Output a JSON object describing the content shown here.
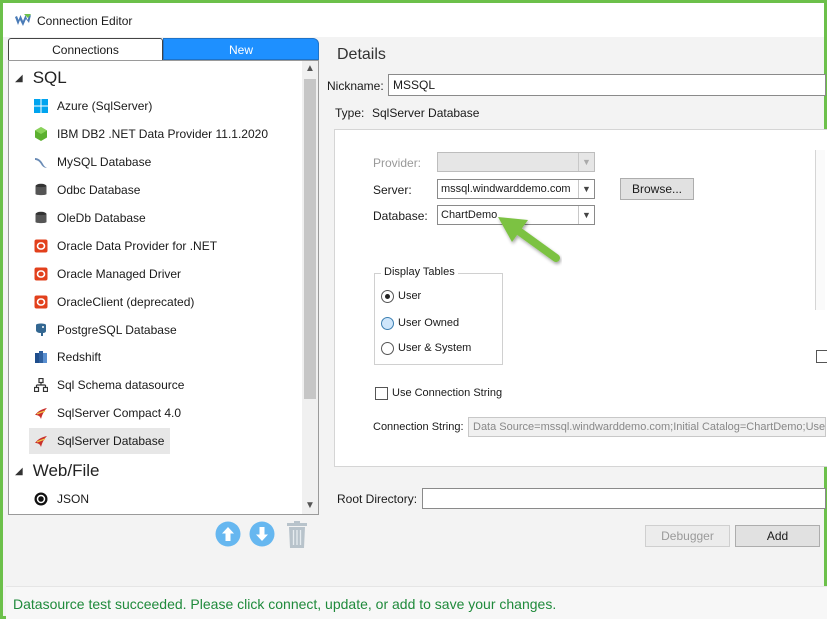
{
  "window": {
    "title": "Connection Editor"
  },
  "tabs": [
    {
      "label": "Connections",
      "active": false
    },
    {
      "label": "New",
      "active": true
    }
  ],
  "tree": {
    "groups": [
      {
        "label": "SQL",
        "items": [
          {
            "label": "Azure (SqlServer)",
            "icon": "windows-icon",
            "color": "#00a4ef"
          },
          {
            "label": "IBM DB2 .NET Data Provider 11.1.2020",
            "icon": "ibm-db2-icon",
            "color": "#5cb030"
          },
          {
            "label": "MySQL Database",
            "icon": "mysql-dolphin-icon",
            "color": "#6a8bb5"
          },
          {
            "label": "Odbc Database",
            "icon": "database-icon",
            "color": "#333333"
          },
          {
            "label": "OleDb Database",
            "icon": "database-icon",
            "color": "#333333"
          },
          {
            "label": "Oracle Data Provider for .NET",
            "icon": "oracle-icon",
            "color": "#e2401c"
          },
          {
            "label": "Oracle Managed Driver",
            "icon": "oracle-icon",
            "color": "#e2401c"
          },
          {
            "label": "OracleClient (deprecated)",
            "icon": "oracle-icon",
            "color": "#e2401c"
          },
          {
            "label": "PostgreSQL Database",
            "icon": "postgresql-elephant-icon",
            "color": "#336791"
          },
          {
            "label": "Redshift",
            "icon": "redshift-icon",
            "color": "#2e5f9e"
          },
          {
            "label": "Sql Schema datasource",
            "icon": "schema-tree-icon",
            "color": "#333333"
          },
          {
            "label": "SqlServer Compact  4.0",
            "icon": "sqlserver-icon",
            "color": "#c9302c"
          },
          {
            "label": "SqlServer Database",
            "icon": "sqlserver-icon",
            "color": "#c9302c",
            "selected": true
          }
        ]
      },
      {
        "label": "Web/File",
        "items": [
          {
            "label": "JSON",
            "icon": "json-icon",
            "color": "#111111"
          }
        ]
      }
    ]
  },
  "toolbar": {
    "move_up": "arrow-up-icon",
    "move_down": "arrow-down-icon",
    "delete": "trash-icon"
  },
  "details": {
    "heading": "Details",
    "nickname_label": "Nickname:",
    "nickname_value": "MSSQL",
    "type_label": "Type:",
    "type_value": "SqlServer Database",
    "provider_label": "Provider:",
    "provider_value": "",
    "server_label": "Server:",
    "server_value": "mssql.windwarddemo.com",
    "browse_label": "Browse...",
    "database_label": "Database:",
    "database_value": "ChartDemo",
    "display_tables": {
      "title": "Display Tables",
      "options": [
        "User",
        "User Owned",
        "User & System"
      ],
      "selected": "User"
    },
    "use_connection_string_label": "Use Connection String",
    "connection_string_label": "Connection String:",
    "connection_string_value": "Data Source=mssql.windwarddemo.com;Initial Catalog=ChartDemo;User",
    "root_directory_label": "Root Directory:",
    "root_directory_value": ""
  },
  "buttons": {
    "debugger": "Debugger",
    "add": "Add"
  },
  "status": {
    "message": "Datasource test succeeded. Please click connect, update, or add to save your changes."
  },
  "colors": {
    "accent": "#1e90ff",
    "frame": "#6cc04a",
    "success": "#1f8a3b"
  }
}
